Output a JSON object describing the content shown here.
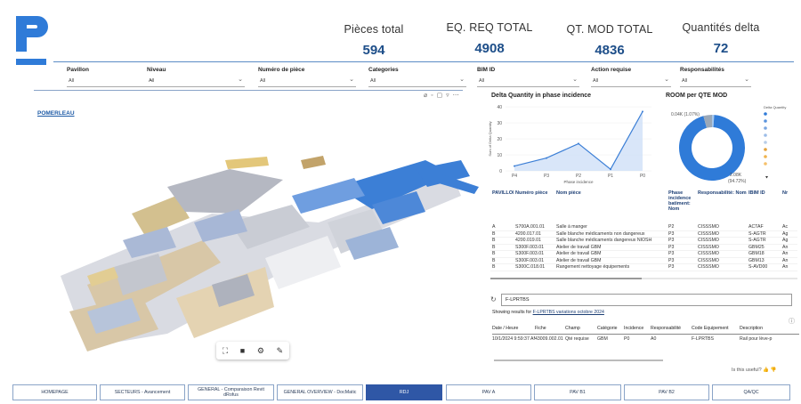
{
  "kpis": [
    {
      "label": "Pièces total",
      "value": "594"
    },
    {
      "label": "EQ. REQ TOTAL",
      "value": "4908"
    },
    {
      "label": "QT. MOD TOTAL",
      "value": "4836"
    },
    {
      "label": "Quantités delta",
      "value": "72"
    }
  ],
  "filters": [
    {
      "label": "Pavillon",
      "value": "All"
    },
    {
      "label": "Niveau",
      "value": "All"
    },
    {
      "label": "Numéro de pièce",
      "value": "All"
    },
    {
      "label": "Categories",
      "value": "All"
    },
    {
      "label": "BIM ID",
      "value": "All"
    },
    {
      "label": "Action requise",
      "value": "All"
    },
    {
      "label": "Responsabilités",
      "value": "All"
    }
  ],
  "viewer": {
    "brand_label": "POMERLEAU",
    "header_icons": "⌀ ◦ ▢ ▿ ⋯"
  },
  "line_chart": {
    "title": "Delta Quantity in phase incidence",
    "ylabel": "Sum of Delta Quantity",
    "xlabel": "Phase incidence",
    "color": "#3c7fd6"
  },
  "donut_chart": {
    "title": "ROOM per QTE MOD",
    "legend_title": "Delta Quantity",
    "label_small": "0.04K (1.07%)",
    "label_big_1": "2.08K",
    "label_big_2": "(94.72%)"
  },
  "chart_data": [
    {
      "type": "area",
      "title": "Delta Quantity in phase incidence",
      "xlabel": "Phase incidence",
      "ylabel": "Sum of Delta Quantity",
      "categories": [
        "P4",
        "P3",
        "P2",
        "P1",
        "P0"
      ],
      "values": [
        3,
        8,
        17,
        1,
        37
      ],
      "ylim": [
        0,
        40
      ],
      "yticks": [
        0,
        10,
        20,
        30,
        40
      ]
    },
    {
      "type": "pie",
      "title": "ROOM per QTE MOD",
      "labels": [
        "0.04K (1.07%)",
        "2.08K (94.72%)"
      ],
      "values": [
        1.07,
        94.72,
        4.21
      ],
      "colors": [
        "#a6c8ee",
        "#2f7bd8",
        "#9aa8b8"
      ]
    }
  ],
  "table1": {
    "headers": [
      "PAVILLON",
      "Numéro pièce",
      "Nom pièce",
      "Phase incidence batiment: Nom",
      "Responsabilité: Nom",
      "IBIM ID",
      "Nr"
    ],
    "rows": [
      [
        "A",
        "S700A.001.01",
        "Salle à manger",
        "P2",
        "CISSSMO",
        "ACTAF",
        "Ac"
      ],
      [
        "B",
        "4200.017.01",
        "Salle blanche médicaments non dangereux",
        "P3",
        "CISSSMO",
        "S-AGTR",
        "Ag"
      ],
      [
        "B",
        "4200.019.01",
        "Salle blanche médicaments dangereux NIOSH",
        "P3",
        "CISSSMO",
        "S-AGTR",
        "Ag"
      ],
      [
        "B",
        "S300F.003.01",
        "Atelier de travail GBM",
        "P3",
        "CISSSMO",
        "GBM25",
        "An"
      ],
      [
        "B",
        "S300F.003.01",
        "Atelier de travail GBM",
        "P3",
        "CISSSMO",
        "GBM18",
        "An"
      ],
      [
        "B",
        "S300F.003.01",
        "Atelier de travail GBM",
        "P3",
        "CISSSMO",
        "GBM13",
        "An"
      ],
      [
        "B",
        "S300C.018.01",
        "Rangement nettoyage équipements",
        "P3",
        "CISSSMO",
        "S-AVD00",
        "An"
      ]
    ]
  },
  "search": {
    "value": "F-LPRTBS",
    "caption_prefix": "Showing results for ",
    "caption_link": "F-LPRTBS variations octobre 2024"
  },
  "table2": {
    "headers": [
      "Date / Heure",
      "Fiche",
      "Champ",
      "Catégorie",
      "Incidence",
      "Responsabilité",
      "Code Équipement",
      "Description"
    ],
    "rows": [
      [
        "10/1/2024 9:59:37 AM",
        "43009.002.01",
        "Qté requise",
        "GBM",
        "P0",
        "A0",
        "F-LPRTBS",
        "Rail pour lève-p"
      ]
    ]
  },
  "feedback": "Is this useful?",
  "nav": [
    {
      "label": "HOMEPAGE",
      "active": false
    },
    {
      "label": "SECTEURS - Avancement",
      "active": false
    },
    {
      "label": "GENERAL - Comparaison Revit dRofus",
      "active": false
    },
    {
      "label": "GENERAL OVERVIEW - DocMatic",
      "active": false
    },
    {
      "label": "RDJ",
      "active": true
    },
    {
      "label": "PAV A",
      "active": false
    },
    {
      "label": "PAV B1",
      "active": false
    },
    {
      "label": "PAV B2",
      "active": false
    },
    {
      "label": "QA/QC",
      "active": false
    }
  ]
}
